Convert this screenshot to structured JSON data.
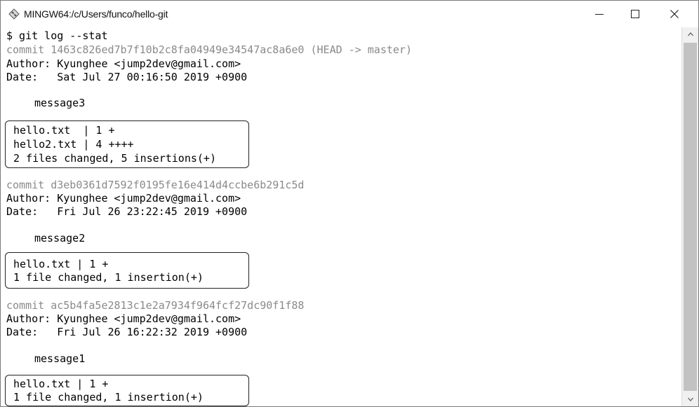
{
  "window": {
    "title": "MINGW64:/c/Users/funco/hello-git",
    "icon": "git-bash-icon",
    "controls": {
      "minimize": "minimize-icon",
      "maximize": "maximize-icon",
      "close": "close-icon"
    }
  },
  "terminal": {
    "prompt_line": "$ git log --stat",
    "commits": [
      {
        "commit_line": "commit 1463c826ed7b7f10b2c8fa04949e34547ac8a6e0 (HEAD -> master)",
        "author_line": "Author: Kyunghee <jump2dev@gmail.com>",
        "date_line": "Date:   Sat Jul 27 00:16:50 2019 +0900",
        "message": "message3",
        "stats": [
          "hello.txt  | 1 +",
          "hello2.txt | 4 ++++",
          "2 files changed, 5 insertions(+)"
        ]
      },
      {
        "commit_line": "commit d3eb0361d7592f0195fe16e414d4ccbe6b291c5d",
        "author_line": "Author: Kyunghee <jump2dev@gmail.com>",
        "date_line": "Date:   Fri Jul 26 23:22:45 2019 +0900",
        "message": "message2",
        "stats": [
          "hello.txt | 1 +",
          "1 file changed, 1 insertion(+)"
        ]
      },
      {
        "commit_line": "commit ac5b4fa5e2813c1e2a7934f964fcf27dc90f1f88",
        "author_line": "Author: Kyunghee <jump2dev@gmail.com>",
        "date_line": "Date:   Fri Jul 26 16:22:32 2019 +0900",
        "message": "message1",
        "stats": [
          "hello.txt | 1 +",
          "1 file changed, 1 insertion(+)"
        ]
      }
    ]
  },
  "colors": {
    "commit_text": "#8a8a8a",
    "text": "#000000",
    "background": "#ffffff",
    "scroll_thumb": "#c2c2c2"
  }
}
